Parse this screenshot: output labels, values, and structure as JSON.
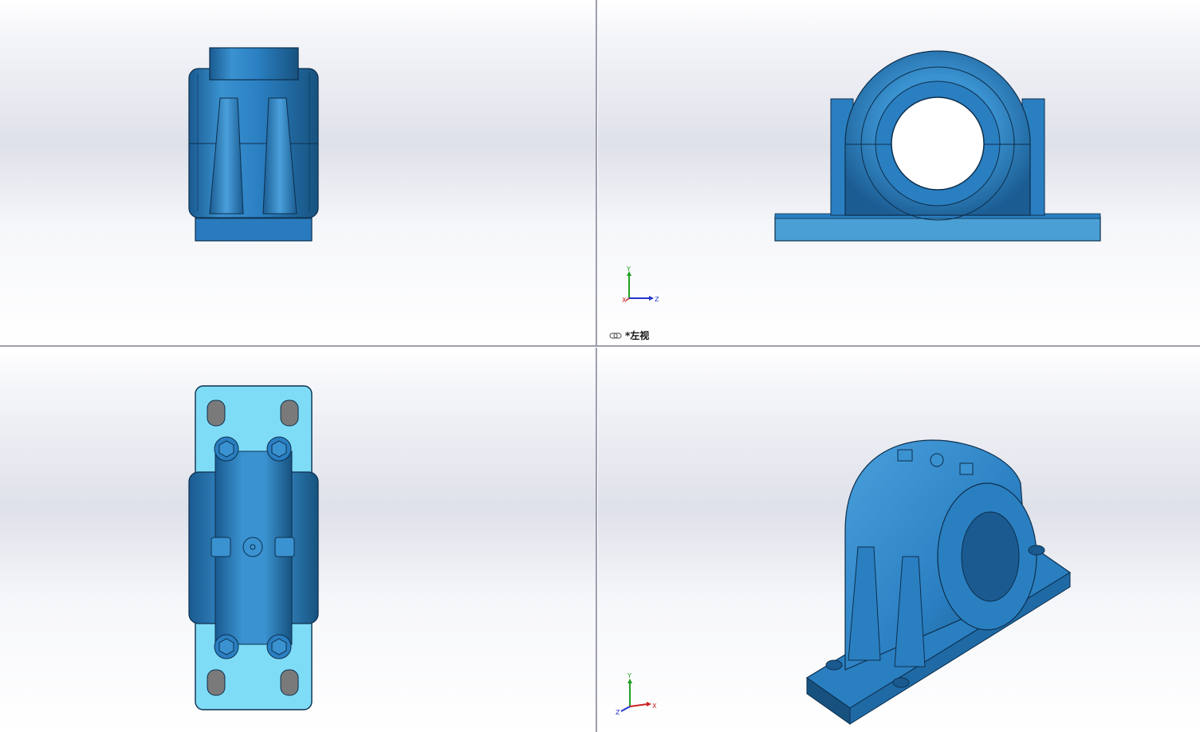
{
  "viewports": {
    "front": {
      "view": "front"
    },
    "left": {
      "view": "left",
      "label": "*左视",
      "link_icon": "link-icon"
    },
    "top": {
      "view": "top"
    },
    "iso": {
      "view": "isometric"
    }
  },
  "triad": {
    "left": {
      "axes": [
        "Y",
        "Z",
        "X"
      ]
    },
    "iso": {
      "axes": [
        "Y",
        "X",
        "Z"
      ]
    }
  },
  "colors": {
    "part_blue": "#2a7fc1",
    "part_dark": "#1a5b92",
    "part_light": "#5aa5d8",
    "top_face": "#7fdcf7",
    "axis_x": "#cc2222",
    "axis_y": "#22a022",
    "axis_z": "#2233cc"
  }
}
